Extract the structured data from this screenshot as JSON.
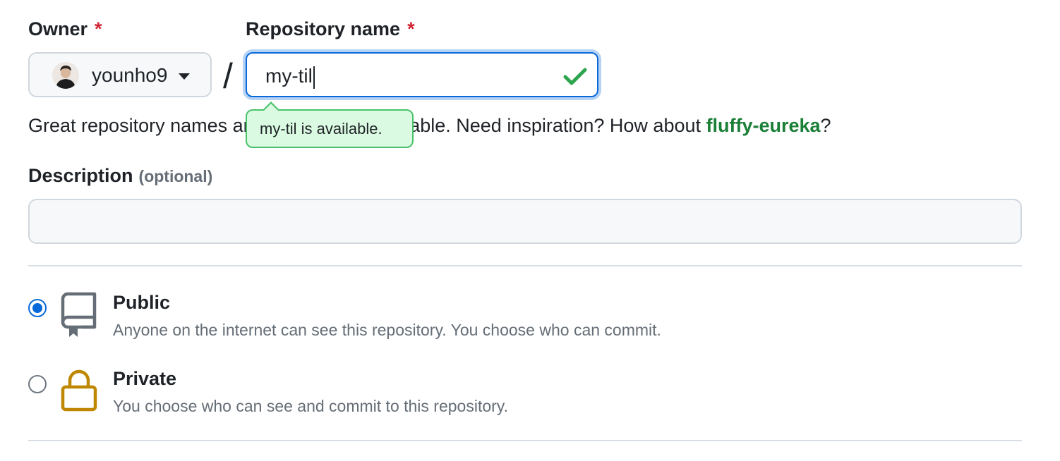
{
  "owner": {
    "label": "Owner",
    "required_mark": "*",
    "selected": "younho9"
  },
  "separator": "/",
  "repository": {
    "label": "Repository name",
    "required_mark": "*",
    "value": "my-til",
    "availability_tooltip": "my-til is available."
  },
  "help": {
    "text_before": "Great repository names are short and memorable. Need inspiration? How about ",
    "suggestion": "fluffy-eureka",
    "text_after": "?"
  },
  "description": {
    "label": "Description",
    "optional_label": "(optional)",
    "value": ""
  },
  "visibility": {
    "options": [
      {
        "title": "Public",
        "description": "Anyone on the internet can see this repository. You choose who can commit.",
        "checked": true,
        "icon": "repo-icon"
      },
      {
        "title": "Private",
        "description": "You choose who can see and commit to this repository.",
        "checked": false,
        "icon": "lock-icon"
      }
    ]
  },
  "colors": {
    "accent": "#0969da",
    "success": "#1a7f37",
    "required": "#cf222e",
    "lock": "#bf8700"
  }
}
